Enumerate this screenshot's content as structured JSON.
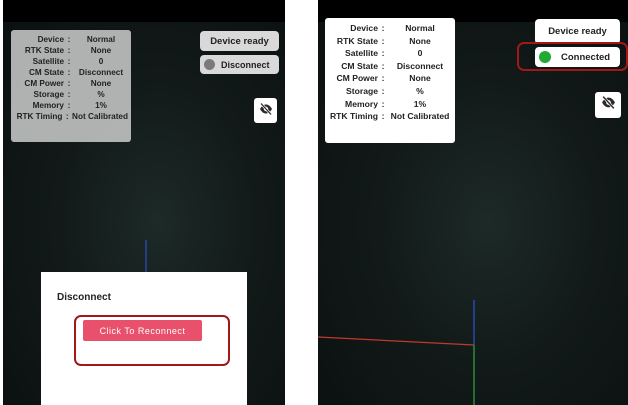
{
  "panels": [
    {
      "status": [
        {
          "label": "Device",
          "colon": ":",
          "value": "Normal"
        },
        {
          "label": "RTK State",
          "colon": ":",
          "value": "None"
        },
        {
          "label": "Satellite",
          "colon": ":",
          "value": "0"
        },
        {
          "label": "CM State",
          "colon": ":",
          "value": "Disconnect"
        },
        {
          "label": "CM Power",
          "colon": ":",
          "value": "None"
        },
        {
          "label": "Storage",
          "colon": ":",
          "value": "%"
        },
        {
          "label": "Memory",
          "colon": ":",
          "value": "1%"
        },
        {
          "label": "RTK Timing",
          "colon": ":",
          "value": "Not Calibrated"
        }
      ],
      "device_button": "Device ready",
      "connection": {
        "label": "Disconnect",
        "state": "disconnected",
        "dot_color": "#7b7b7b"
      },
      "visibility_icon": "eye-off-icon",
      "dialog": {
        "title": "Disconnect",
        "button": "Click To Reconnect"
      }
    },
    {
      "status": [
        {
          "label": "Device",
          "colon": ":",
          "value": "Normal"
        },
        {
          "label": "RTK State",
          "colon": ":",
          "value": "None"
        },
        {
          "label": "Satellite",
          "colon": ":",
          "value": "0"
        },
        {
          "label": "CM State",
          "colon": ":",
          "value": "Disconnect"
        },
        {
          "label": "CM Power",
          "colon": ":",
          "value": "None"
        },
        {
          "label": "Storage",
          "colon": ":",
          "value": "%"
        },
        {
          "label": "Memory",
          "colon": ":",
          "value": "1%"
        },
        {
          "label": "RTK Timing",
          "colon": ":",
          "value": "Not Calibrated"
        }
      ],
      "device_button": "Device ready",
      "connection": {
        "label": "Connected",
        "state": "connected",
        "dot_color": "#1faa34"
      },
      "visibility_icon": "eye-off-icon"
    }
  ],
  "colors": {
    "reconnect_button": "#e8506b",
    "highlight_border": "#a01818",
    "axis_x": "#c0392b",
    "axis_y": "#2e9e3e",
    "axis_z": "#2c4fc7"
  }
}
